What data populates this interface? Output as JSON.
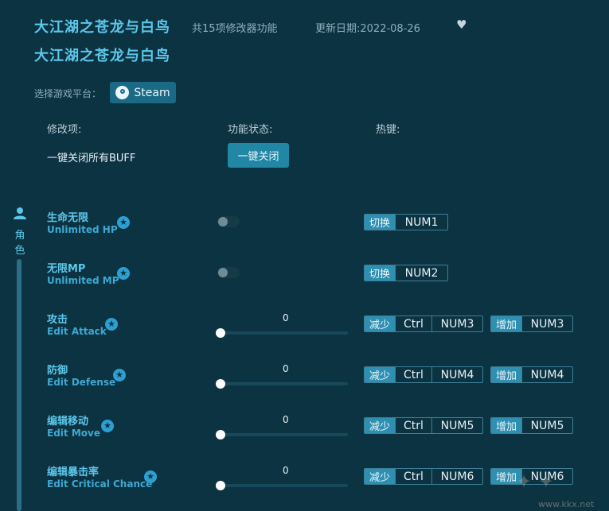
{
  "header": {
    "title": "大江湖之苍龙与白鸟",
    "subtitle": "大江湖之苍龙与白鸟",
    "feature_count": "共15项修改器功能",
    "update_date": "更新日期:2022-08-26"
  },
  "platform": {
    "label": "选择游戏平台：",
    "steam_label": "Steam"
  },
  "columns": {
    "mod": "修改项:",
    "status": "功能状态:",
    "hotkey": "热键:"
  },
  "buff": {
    "label": "一键关闭所有BUFF",
    "button": "一键关闭"
  },
  "sidebar": {
    "category": "角色"
  },
  "rows": [
    {
      "cn": "生命无限",
      "en": "Unlimited HP",
      "type": "toggle",
      "enabled": false,
      "hotkeys": [
        {
          "tag": "切换",
          "keys": [
            "NUM1"
          ]
        }
      ]
    },
    {
      "cn": "无限MP",
      "en": "Unlimited MP",
      "type": "toggle",
      "enabled": false,
      "hotkeys": [
        {
          "tag": "切换",
          "keys": [
            "NUM2"
          ]
        }
      ]
    },
    {
      "cn": "攻击",
      "en": "Edit Attack",
      "type": "slider",
      "value": "0",
      "hotkeys": [
        {
          "tag": "减少",
          "keys": [
            "Ctrl",
            "NUM3"
          ]
        },
        {
          "tag": "增加",
          "keys": [
            "NUM3"
          ]
        }
      ]
    },
    {
      "cn": "防御",
      "en": "Edit Defense",
      "type": "slider",
      "value": "0",
      "hotkeys": [
        {
          "tag": "减少",
          "keys": [
            "Ctrl",
            "NUM4"
          ]
        },
        {
          "tag": "增加",
          "keys": [
            "NUM4"
          ]
        }
      ]
    },
    {
      "cn": "编辑移动",
      "en": "Edit Move",
      "type": "slider",
      "value": "0",
      "hotkeys": [
        {
          "tag": "减少",
          "keys": [
            "Ctrl",
            "NUM5"
          ]
        },
        {
          "tag": "增加",
          "keys": [
            "NUM5"
          ]
        }
      ]
    },
    {
      "cn": "编辑暴击率",
      "en": "Edit Critical Chance",
      "type": "slider",
      "value": "0",
      "hotkeys": [
        {
          "tag": "减少",
          "keys": [
            "Ctrl",
            "NUM6"
          ]
        },
        {
          "tag": "增加",
          "keys": [
            "NUM6"
          ]
        }
      ]
    }
  ],
  "watermark": "www.kkx.net",
  "icons": {
    "favorite": "heart-icon",
    "steam": "steam-icon",
    "category": "user-icon",
    "info": "star-icon"
  },
  "colors": {
    "background": "#0c3342",
    "accent": "#5cc7ea",
    "button": "#2187a5"
  }
}
